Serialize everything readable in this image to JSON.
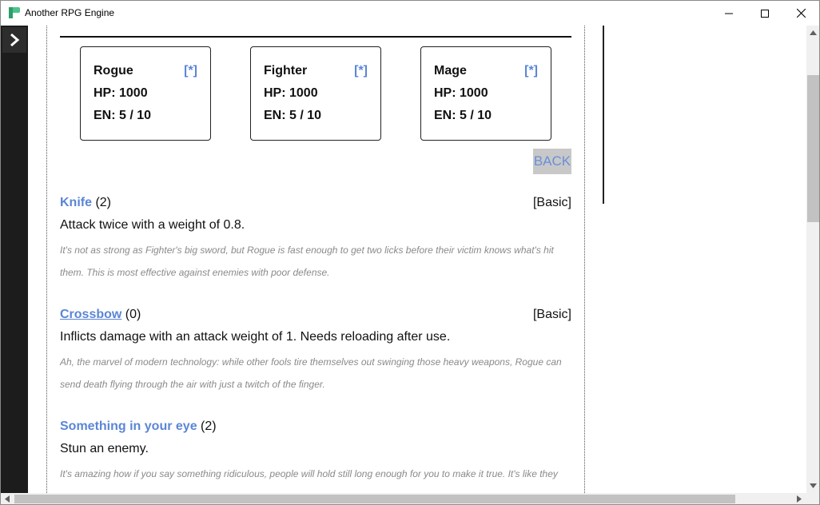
{
  "window": {
    "title": "Another RPG Engine",
    "accent": "#3cb371"
  },
  "characters": [
    {
      "name": "Rogue",
      "star": "[*]",
      "hp": "HP: 1000",
      "en": "EN: 5 / 10"
    },
    {
      "name": "Fighter",
      "star": "[*]",
      "hp": "HP: 1000",
      "en": "EN: 5 / 10"
    },
    {
      "name": "Mage",
      "star": "[*]",
      "hp": "HP: 1000",
      "en": "EN: 5 / 10"
    }
  ],
  "back_label": "BACK",
  "skills": [
    {
      "name": "Knife",
      "count": "(2)",
      "tag": "[Basic]",
      "desc": "Attack twice with a weight of 0.8.",
      "flavor": "It's not as strong as Fighter's big sword, but Rogue is fast enough to get two licks before their victim knows what's hit them. This is most effective against enemies with poor defense."
    },
    {
      "name": "Crossbow",
      "count": "(0)",
      "tag": "[Basic]",
      "desc": "Inflicts damage with an attack weight of 1. Needs reloading after use.",
      "flavor": "Ah, the marvel of modern technology: while other fools tire themselves out swinging those heavy weapons, Rogue can send death flying through the air with just a twitch of the finger."
    },
    {
      "name": "Something in your eye",
      "count": "(2)",
      "tag": "",
      "desc": "Stun an enemy.",
      "flavor": "It's amazing how if you say something ridiculous, people will hold still long enough for you to make it true. It's like they"
    }
  ],
  "colors": {
    "link": "#5b86d6",
    "sidebar": "#1c1c1c",
    "flavor": "#8a8a8a"
  }
}
